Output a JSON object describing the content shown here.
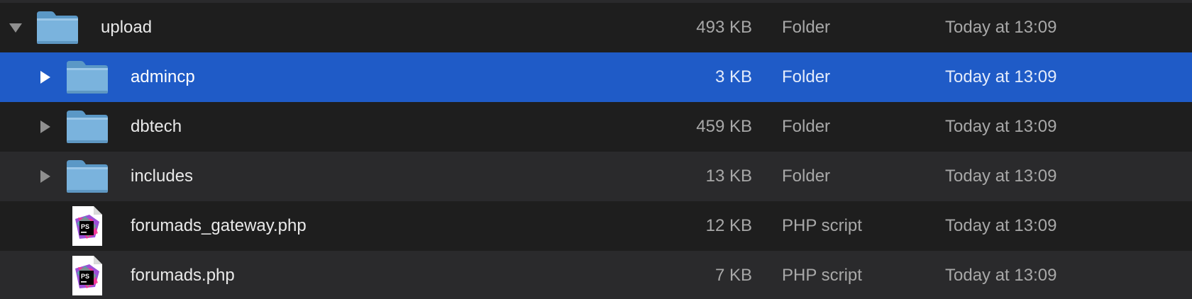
{
  "rows": [
    {
      "name": "upload",
      "size": "493 KB",
      "kind": "Folder",
      "date": "Today at 13:09",
      "type": "folder",
      "expanded": true,
      "selected": false,
      "level": 0
    },
    {
      "name": "admincp",
      "size": "3 KB",
      "kind": "Folder",
      "date": "Today at 13:09",
      "type": "folder",
      "expanded": false,
      "selected": true,
      "level": 1
    },
    {
      "name": "dbtech",
      "size": "459 KB",
      "kind": "Folder",
      "date": "Today at 13:09",
      "type": "folder",
      "expanded": false,
      "selected": false,
      "level": 1
    },
    {
      "name": "includes",
      "size": "13 KB",
      "kind": "Folder",
      "date": "Today at 13:09",
      "type": "folder",
      "expanded": false,
      "selected": false,
      "level": 1
    },
    {
      "name": "forumads_gateway.php",
      "size": "12 KB",
      "kind": "PHP script",
      "date": "Today at 13:09",
      "type": "php",
      "selected": false,
      "level": 1
    },
    {
      "name": "forumads.php",
      "size": "7 KB",
      "kind": "PHP script",
      "date": "Today at 13:09",
      "type": "php",
      "selected": false,
      "level": 1
    }
  ],
  "icons": {
    "folder": "folder-icon",
    "php": "phpstorm-file-icon",
    "expanded": "disclosure-triangle-down-icon",
    "collapsed": "disclosure-triangle-right-icon"
  },
  "colors": {
    "selection": "#1f5bc7",
    "row_alt": "#2a2a2c",
    "row_base": "#1e1e1e",
    "folder": "#6aa9d6"
  }
}
